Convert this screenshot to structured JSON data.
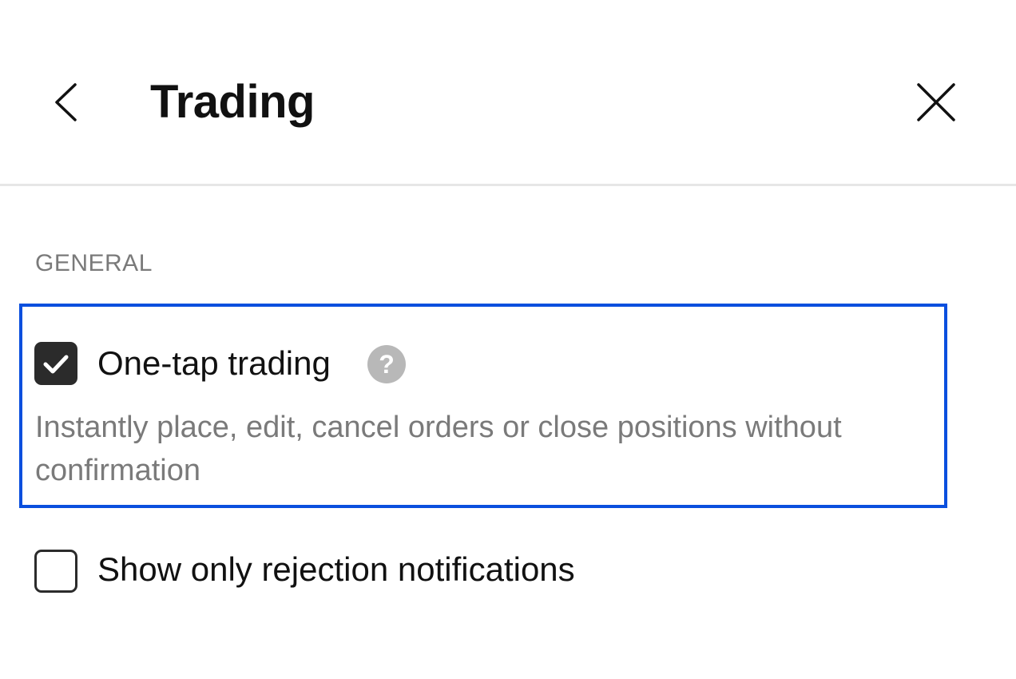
{
  "header": {
    "title": "Trading",
    "back_icon": "chevron-left-icon",
    "close_icon": "close-icon"
  },
  "section": {
    "label": "GENERAL"
  },
  "settings": [
    {
      "label": "One-tap trading",
      "checked": true,
      "help_icon": "question-mark-icon",
      "help_glyph": "?",
      "description": "Instantly place, edit, cancel orders or close positions without confirmation",
      "highlighted": true
    },
    {
      "label": "Show only rejection notifications",
      "checked": false
    }
  ],
  "colors": {
    "highlight_border": "#0a4fde",
    "checkbox_fill": "#2b2b2b",
    "help_icon_bg": "#b8b8b8",
    "muted_text": "#7a7a7a"
  }
}
